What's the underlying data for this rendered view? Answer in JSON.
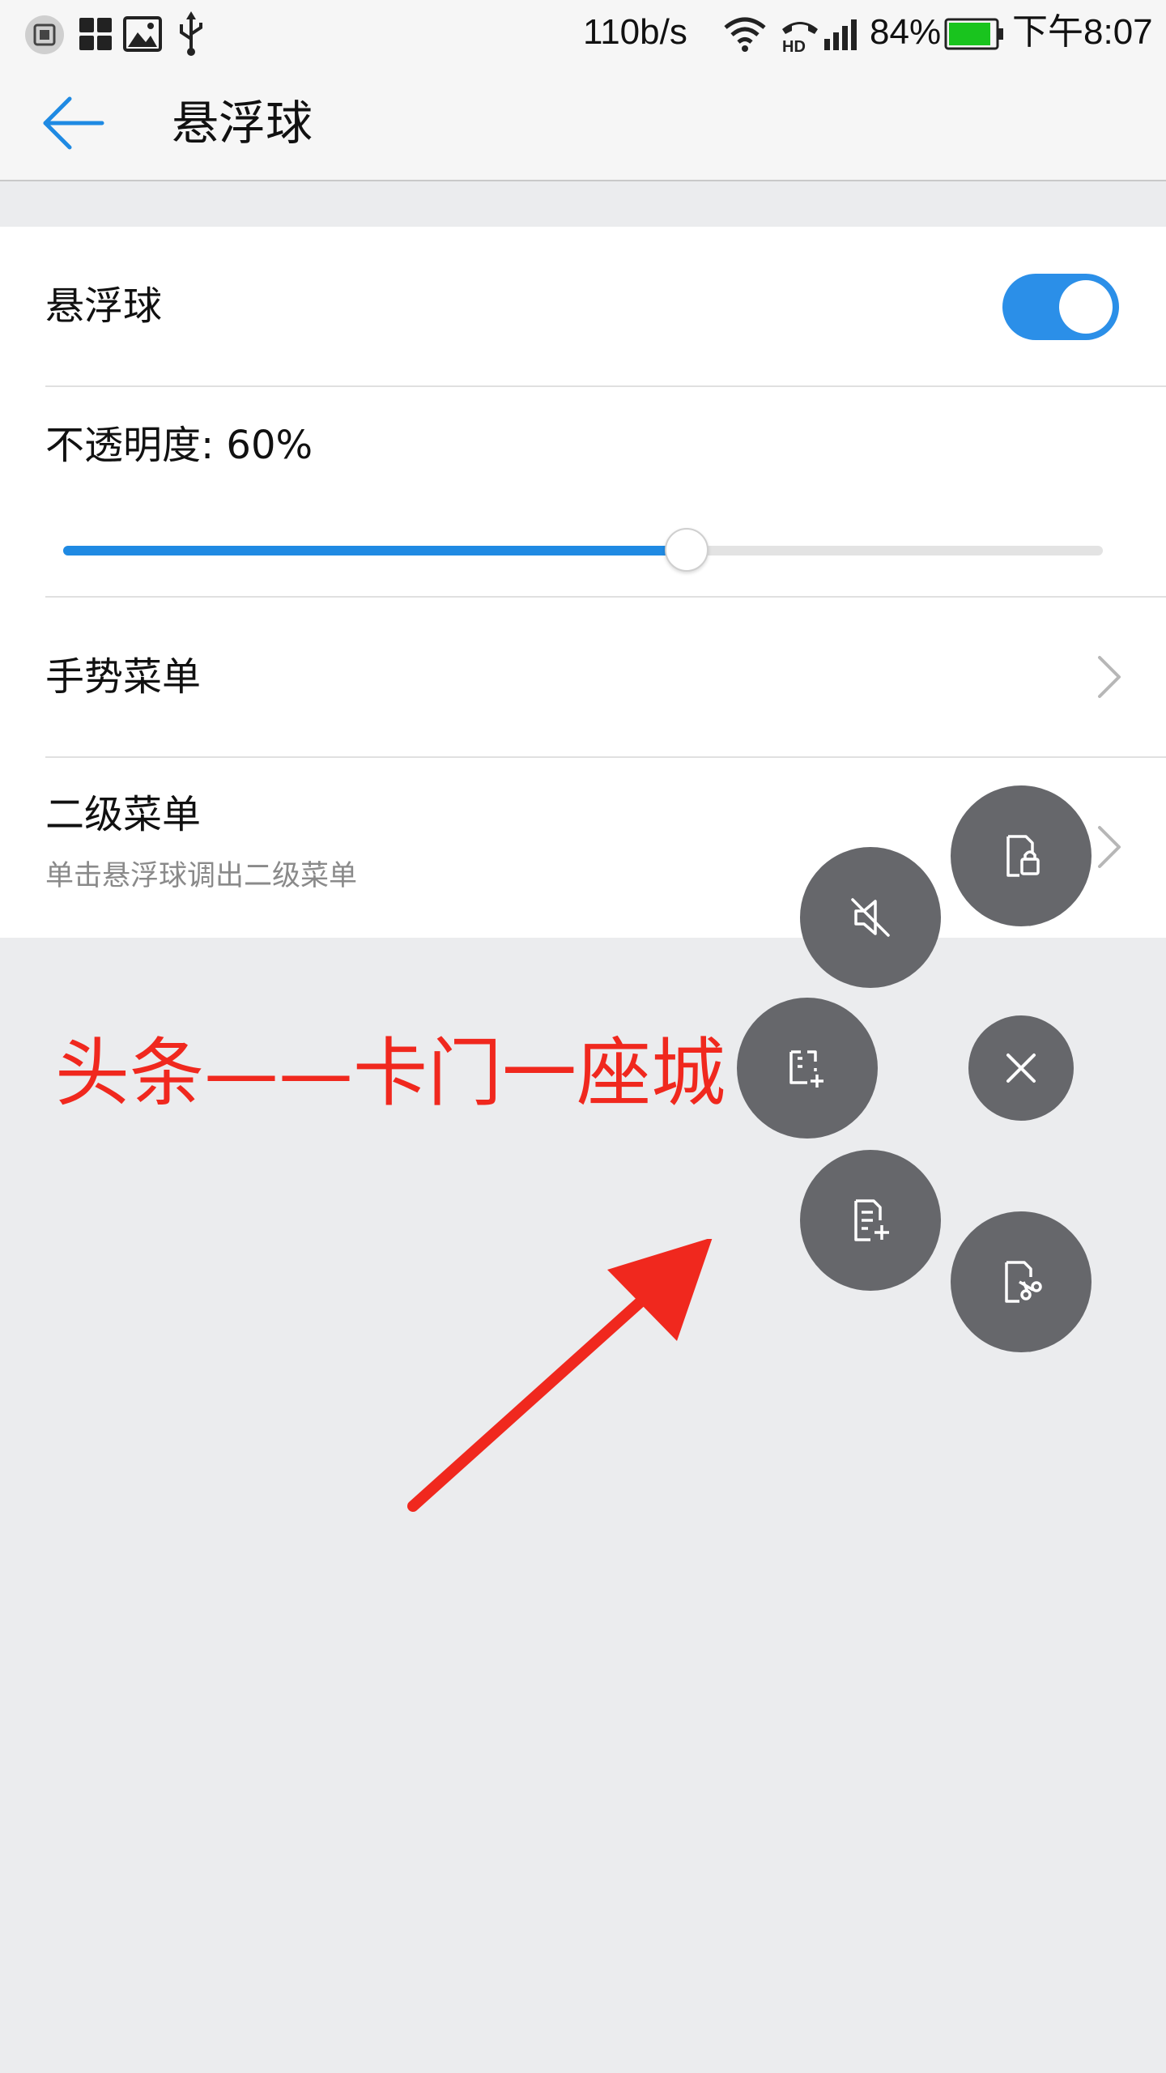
{
  "status_bar": {
    "network_speed": "110b/s",
    "battery_percent": "84%",
    "time": "下午8:07",
    "icons": [
      "screenshot-icon",
      "apps-icon",
      "image-icon",
      "usb-icon",
      "wifi-icon",
      "hd-call-icon",
      "signal-icon",
      "battery-icon"
    ],
    "battery_color": "#19c41e"
  },
  "title_bar": {
    "title": "悬浮球",
    "accent_color": "#1f8ae3"
  },
  "settings": {
    "floating_ball": {
      "label": "悬浮球",
      "enabled": true
    },
    "opacity": {
      "label": "不透明度: 60%",
      "value": 0.6
    },
    "gesture_menu": {
      "label": "手势菜单"
    },
    "secondary_menu": {
      "label": "二级菜单",
      "description": "单击悬浮球调出二级菜单"
    }
  },
  "floating_menu": {
    "buttons": [
      "lock-screen",
      "mute",
      "screenshot",
      "close",
      "add-note",
      "screen-record"
    ],
    "color": "#66676b"
  },
  "annotation": {
    "text": "头条——卡门一座城",
    "color": "#f0281e"
  }
}
